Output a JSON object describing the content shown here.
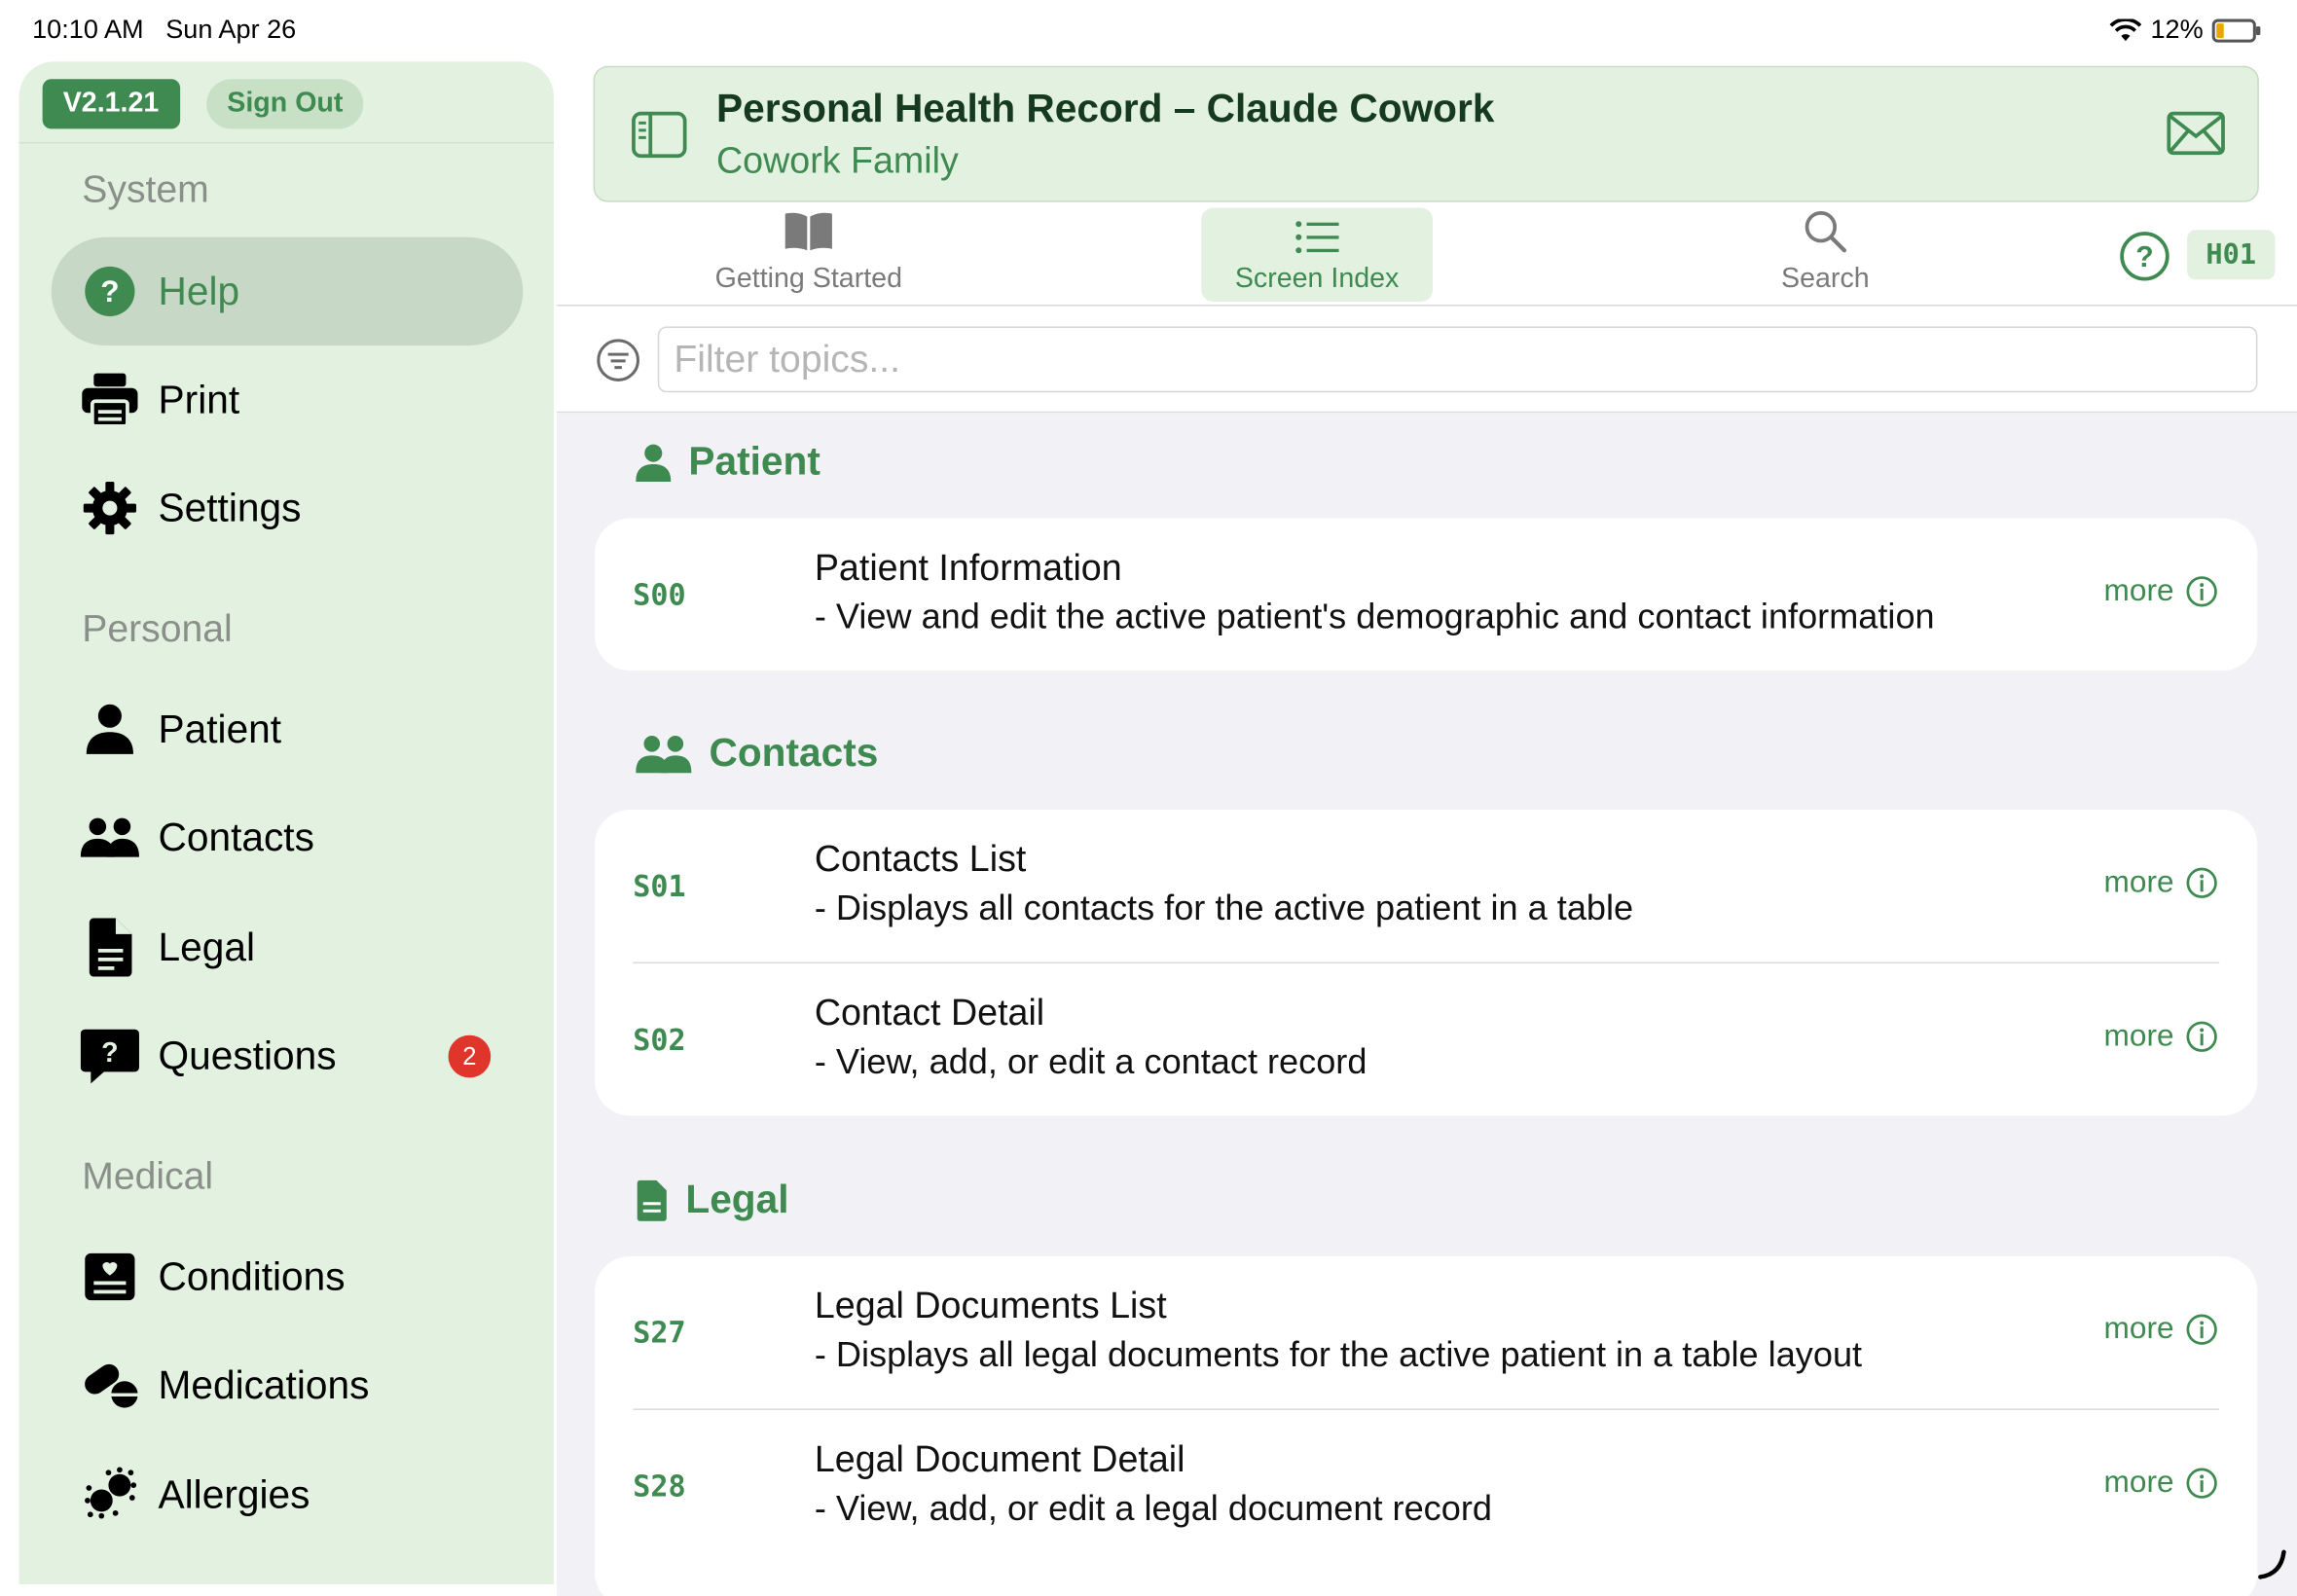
{
  "status_bar": {
    "time": "10:10 AM",
    "date": "Sun Apr 26",
    "battery": "12%"
  },
  "sidebar": {
    "version": "V2.1.21",
    "sign_out": "Sign Out",
    "sections": {
      "system": "System",
      "personal": "Personal",
      "medical": "Medical"
    },
    "items": [
      {
        "label": "Help",
        "icon": "help-icon"
      },
      {
        "label": "Print",
        "icon": "printer-icon"
      },
      {
        "label": "Settings",
        "icon": "gear-icon"
      },
      {
        "label": "Patient",
        "icon": "person-icon"
      },
      {
        "label": "Contacts",
        "icon": "people-icon"
      },
      {
        "label": "Legal",
        "icon": "document-icon"
      },
      {
        "label": "Questions",
        "icon": "question-bubble-icon",
        "badge": "2"
      },
      {
        "label": "Conditions",
        "icon": "medical-chart-icon"
      },
      {
        "label": "Medications",
        "icon": "pills-icon"
      },
      {
        "label": "Allergies",
        "icon": "allergen-icon"
      }
    ]
  },
  "header": {
    "title": "Personal Health Record – Claude Cowork",
    "subtitle": "Cowork Family"
  },
  "tabs": [
    {
      "label": "Getting Started",
      "icon": "book-icon"
    },
    {
      "label": "Screen Index",
      "icon": "list-icon",
      "active": true
    },
    {
      "label": "Search",
      "icon": "magnifier-icon"
    }
  ],
  "screen_code": "H01",
  "filter": {
    "placeholder": "Filter topics..."
  },
  "groups": [
    {
      "name": "Patient",
      "rows": [
        {
          "code": "S00",
          "title": "Patient Information",
          "desc": "- View and edit the active patient's demographic and contact information",
          "more": "more"
        }
      ]
    },
    {
      "name": "Contacts",
      "rows": [
        {
          "code": "S01",
          "title": "Contacts List",
          "desc": "- Displays all contacts for the active patient in a table",
          "more": "more"
        },
        {
          "code": "S02",
          "title": "Contact Detail",
          "desc": "- View, add, or edit a contact record",
          "more": "more"
        }
      ]
    },
    {
      "name": "Legal",
      "rows": [
        {
          "code": "S27",
          "title": "Legal Documents List",
          "desc": "- Displays all legal documents for the active patient in a table layout",
          "more": "more"
        },
        {
          "code": "S28",
          "title": "Legal Document Detail",
          "desc": "- View, add, or edit a legal document record",
          "more": "more"
        }
      ]
    }
  ],
  "colors": {
    "accent": "#3f8a50",
    "sidebar_bg": "#e3f1e1",
    "badge_red": "#e0352b"
  }
}
